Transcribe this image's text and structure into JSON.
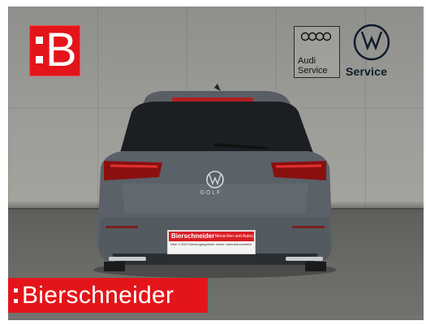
{
  "logo": {
    "letter": "B",
    "color": "#e3151a"
  },
  "audi_service": {
    "line1": "Audi",
    "line2": "Service"
  },
  "vw_service": {
    "label": "Service"
  },
  "car": {
    "badge": "GOLF",
    "plate": {
      "brand": "Bierschneider",
      "tagline": "Menschen und Autos.",
      "info": "Über 1.000 Fahrzeugangebote online: www.bierschneider.de"
    }
  },
  "banner": {
    "text": "Bierschneider",
    "color": "#e3151a"
  }
}
